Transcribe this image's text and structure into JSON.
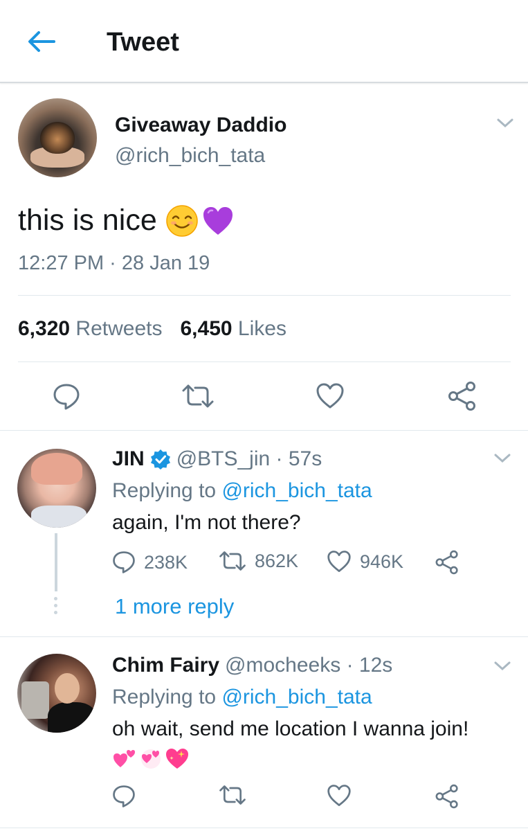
{
  "header": {
    "title": "Tweet"
  },
  "main_tweet": {
    "display_name": "Giveaway Daddio",
    "handle": "@rich_bich_tata",
    "text": "this is nice",
    "timestamp": "12:27 PM · 28 Jan 19",
    "retweets_count": "6,320",
    "retweets_label": "Retweets",
    "likes_count": "6,450",
    "likes_label": "Likes",
    "emojis": [
      "smiling-face-icon",
      "purple-heart-icon"
    ]
  },
  "replies": [
    {
      "display_name": "JIN",
      "verified": true,
      "handle_time": "@BTS_jin · 57s",
      "replying_prefix": "Replying to",
      "replying_to": "@rich_bich_tata",
      "text": "again, I'm not there?",
      "reply_count": "238K",
      "retweet_count": "862K",
      "like_count": "946K",
      "more_replies": "1 more reply"
    },
    {
      "display_name": "Chim Fairy",
      "verified": false,
      "handle_time": "@mocheeks · 12s",
      "replying_prefix": "Replying to",
      "replying_to": "@rich_bich_tata",
      "text": "oh wait, send me location I wanna join!",
      "emojis": [
        "two-hearts-icon",
        "revolving-hearts-icon",
        "sparkling-heart-icon"
      ]
    }
  ],
  "colors": {
    "accent": "#1b95e0",
    "text_primary": "#14171a",
    "text_secondary": "#657786",
    "divider": "#e1e8ed"
  }
}
